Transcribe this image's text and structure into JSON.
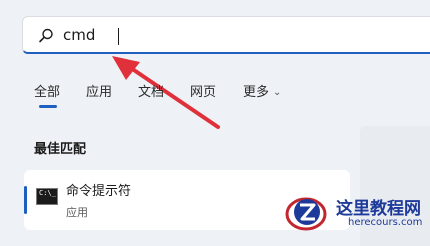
{
  "search": {
    "value": "cmd"
  },
  "tabs": [
    {
      "label": "全部",
      "active": true
    },
    {
      "label": "应用",
      "active": false
    },
    {
      "label": "文档",
      "active": false
    },
    {
      "label": "网页",
      "active": false
    },
    {
      "label": "更多",
      "active": false,
      "has_dropdown": true
    }
  ],
  "best_match": {
    "title": "最佳匹配",
    "item": {
      "name": "命令提示符",
      "type": "应用",
      "icon": "cmd-icon"
    }
  },
  "watermark": {
    "title": "这里教程网",
    "url": "herecours.com"
  },
  "colors": {
    "accent": "#1f5fbf",
    "arrow": "#e0313a",
    "watermark": "#1d3a9a"
  }
}
